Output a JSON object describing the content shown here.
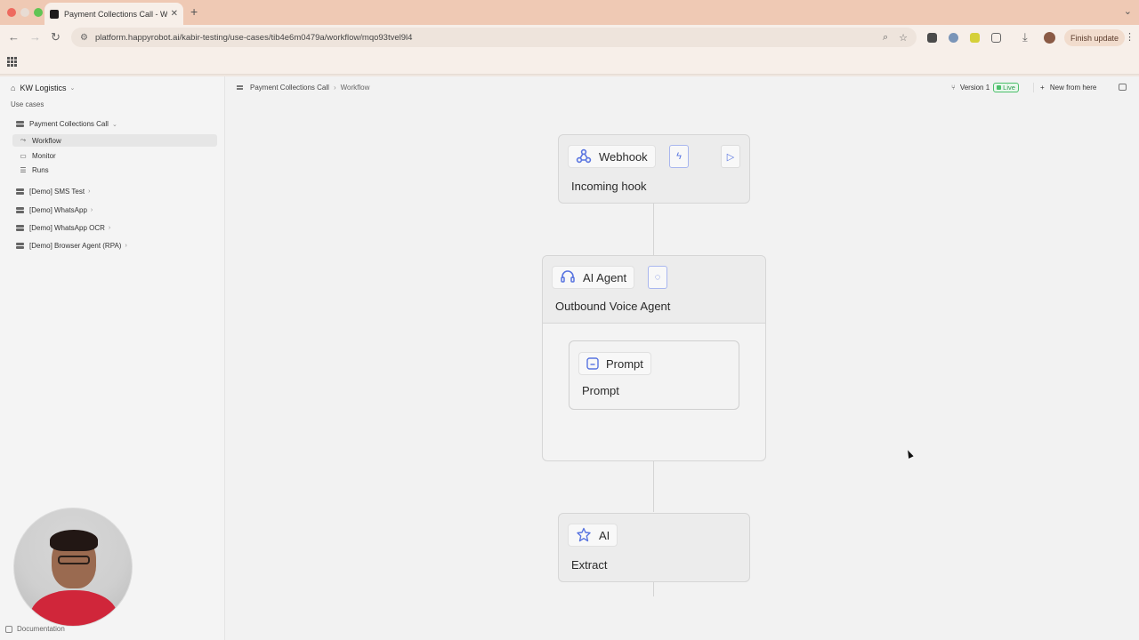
{
  "browser": {
    "tab_title": "Payment Collections Call - W",
    "url": "platform.happyrobot.ai/kabir-testing/use-cases/tib4e6m0479a/workflow/mqo93tvel9l4",
    "finish_update_label": "Finish update",
    "traffic_colors": [
      "#ee6a5f",
      "#f5bd4f",
      "#61c454"
    ]
  },
  "sidebar": {
    "org_name": "KW Logistics",
    "section_label": "Use cases",
    "use_case": "Payment Collections Call",
    "sub_items": [
      {
        "label": "Workflow",
        "active": true
      },
      {
        "label": "Monitor",
        "active": false
      },
      {
        "label": "Runs",
        "active": false
      }
    ],
    "other_use_cases": [
      {
        "label": "[Demo] SMS Test"
      },
      {
        "label": "[Demo] WhatsApp"
      },
      {
        "label": "[Demo] WhatsApp OCR"
      },
      {
        "label": "[Demo] Browser Agent (RPA)"
      }
    ],
    "documentation_label": "Documentation"
  },
  "header": {
    "breadcrumb_root": "Payment Collections Call",
    "breadcrumb_current": "Workflow",
    "version_label": "Version 1",
    "live_label": "Live",
    "new_from_here_label": "New from here"
  },
  "workflow": {
    "webhook": {
      "type": "Webhook",
      "name": "Incoming hook"
    },
    "agent": {
      "type": "AI Agent",
      "name": "Outbound Voice Agent"
    },
    "prompt": {
      "type": "Prompt",
      "name": "Prompt"
    },
    "extract": {
      "type": "AI",
      "name": "Extract"
    }
  },
  "colors": {
    "accent_blue": "#5874e0",
    "live_green": "#4bbf6a"
  }
}
